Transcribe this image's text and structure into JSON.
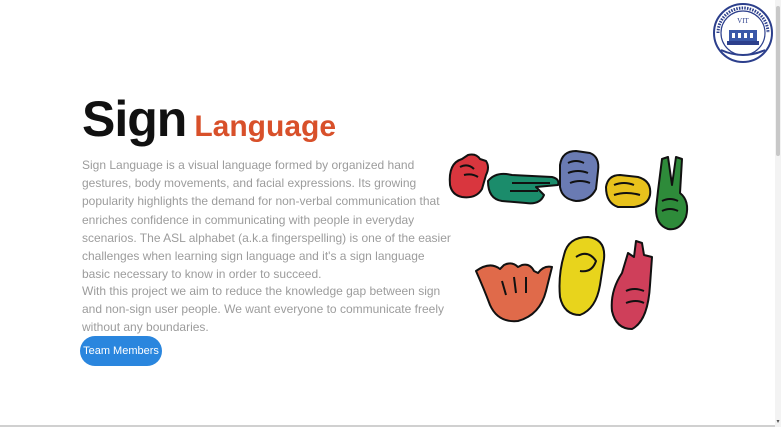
{
  "header": {
    "logo_icon": "vit-institute-seal-icon",
    "logo_text": "VIT"
  },
  "hero": {
    "title_main": "Sign",
    "title_accent": "Language",
    "accent_color": "#d8502a",
    "paragraph_1": "Sign Language is a visual language formed by organized hand gestures, body movements, and facial expressions. Its growing popularity highlights the demand for non-verbal communication that enriches confidence in communicating with people in everyday scenarios. The ASL alphabet (a.k.a fingerspelling) is one of the easier challenges when learning sign language and it's a sign language basic necessary to know in order to succeed.",
    "paragraph_2": "With this project we aim to reduce the knowledge gap between sign and non-sign user people. We want everyone to communicate freely without any boundaries.",
    "cta_label": "Team Members",
    "cta_color": "#2a86de"
  },
  "illustration": {
    "icon": "asl-hand-signs-illustration",
    "hand_colors": [
      "#d9363e",
      "#1b8c6b",
      "#6a7bb3",
      "#e8c21c",
      "#2e8b3a",
      "#e06a4a",
      "#e8d41c",
      "#cf3f5a"
    ]
  }
}
